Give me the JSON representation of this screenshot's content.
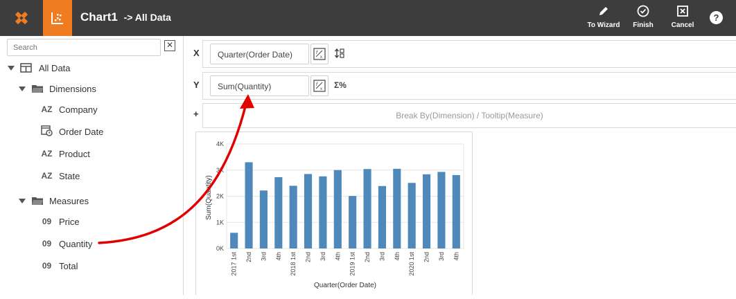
{
  "header": {
    "title": "Chart1",
    "subtitle": "-> All Data",
    "buttons": {
      "to_wizard": "To Wizard",
      "finish": "Finish",
      "cancel": "Cancel"
    },
    "help": "?",
    "colors": {
      "bar": "#3d3d3d",
      "accent": "#f07c22"
    }
  },
  "sidebar": {
    "search_placeholder": "Search",
    "clear": "✕",
    "root": "All Data",
    "groups": [
      {
        "label": "Dimensions",
        "items": [
          {
            "icon": "AZ",
            "label": "Company"
          },
          {
            "icon": "date-icon",
            "label": "Order Date"
          },
          {
            "icon": "AZ",
            "label": "Product"
          },
          {
            "icon": "AZ",
            "label": "State"
          }
        ]
      },
      {
        "label": "Measures",
        "items": [
          {
            "icon": "09",
            "label": "Price"
          },
          {
            "icon": "09",
            "label": "Quantity"
          },
          {
            "icon": "09",
            "label": "Total"
          }
        ]
      }
    ]
  },
  "axes": {
    "x": {
      "label": "X",
      "field": "Quarter(Order Date)"
    },
    "y": {
      "label": "Y",
      "field": "Sum(Quantity)",
      "icon_text": "Σ%"
    },
    "plus": "+",
    "breakby": "Break By(Dimension) / Tooltip(Measure)"
  },
  "chart_data": {
    "type": "bar",
    "xlabel": "Quarter(Order Date)",
    "ylabel": "Sum(Quantity)",
    "ylim": [
      0,
      4000
    ],
    "yticks": [
      "0K",
      "1K",
      "2K",
      "3K",
      "4K"
    ],
    "bar_color": "#4f88ba",
    "categories": [
      "2017 1st",
      "2nd",
      "3rd",
      "4th",
      "2018 1st",
      "2nd",
      "3rd",
      "4th",
      "2019 1st",
      "2nd",
      "3rd",
      "4th",
      "2020 1st",
      "2nd",
      "3rd",
      "4th"
    ],
    "values": [
      600,
      3300,
      2220,
      2730,
      2400,
      2850,
      2760,
      3000,
      2010,
      3040,
      2390,
      3050,
      2510,
      2840,
      2930,
      2810
    ]
  }
}
